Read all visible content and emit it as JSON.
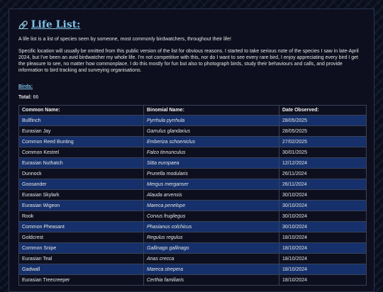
{
  "page": {
    "title": "Life List:",
    "title_icon": "link-icon",
    "intro": "A life list is a list of species seen by someone, most commonly birdwatchers, throughout their life!",
    "note": "Specific location will usually be omitted from this public version of the list for obvious reasons. I started to take serious note of the species I saw in late-April 2024, but I've been an avid birdwatcher my whole life. I'm not competitive with this, nor do I want to see every rare bird, I enjoy appreciating every bird I get the pleasure to see, no matter how commonplace. I do this mostly for fun but also to photograph birds, study their behaviours and calls, and provide information to bird tracking and surveying organisations."
  },
  "birds": {
    "section_label": "Birds:",
    "total_label": "Total:",
    "total_value": "66",
    "columns": [
      "Common Name:",
      "Binomial Name:",
      "Date Observed:"
    ],
    "rows": [
      [
        "Bullfinch",
        "Pyrrhula pyrrhula",
        "28/05/2025"
      ],
      [
        "Eurasian Jay",
        "Garrulus glandarius",
        "28/05/2025"
      ],
      [
        "Common Reed Bunting",
        "Emberiza schoeniclus",
        "27/02/2025"
      ],
      [
        "Common Kestrel",
        "Falco tinnunculus",
        "30/01/2025"
      ],
      [
        "Eurasian Nuthatch",
        "Sitta europaea",
        "12/12/2024"
      ],
      [
        "Dunnock",
        "Prunella modularis",
        "26/11/2024"
      ],
      [
        "Goosander",
        "Mergus merganser",
        "26/11/2024"
      ],
      [
        "Eurasian Skylark",
        "Alauda arvensis",
        "30/10/2024"
      ],
      [
        "Eurasian Wigeon",
        "Mareca penelope",
        "30/10/2024"
      ],
      [
        "Rook",
        "Corvus frugilegus",
        "30/10/2024"
      ],
      [
        "Common Pheasant",
        "Phasianus colchicus",
        "30/10/2024"
      ],
      [
        "Goldcrest",
        "Regulus regulus",
        "18/10/2024"
      ],
      [
        "Common Snipe",
        "Gallinago gallinago",
        "18/10/2024"
      ],
      [
        "Eurasian Teal",
        "Anas crecca",
        "18/10/2024"
      ],
      [
        "Gadwall",
        "Mareca strepera",
        "18/10/2024"
      ],
      [
        "Eurasian Treecreeper",
        "Certhia familiaris",
        "18/10/2024"
      ]
    ]
  },
  "colors": {
    "accent": "#7fc3e8",
    "row_highlight": "#15306a",
    "panel_bg": "#0d0f1e"
  }
}
